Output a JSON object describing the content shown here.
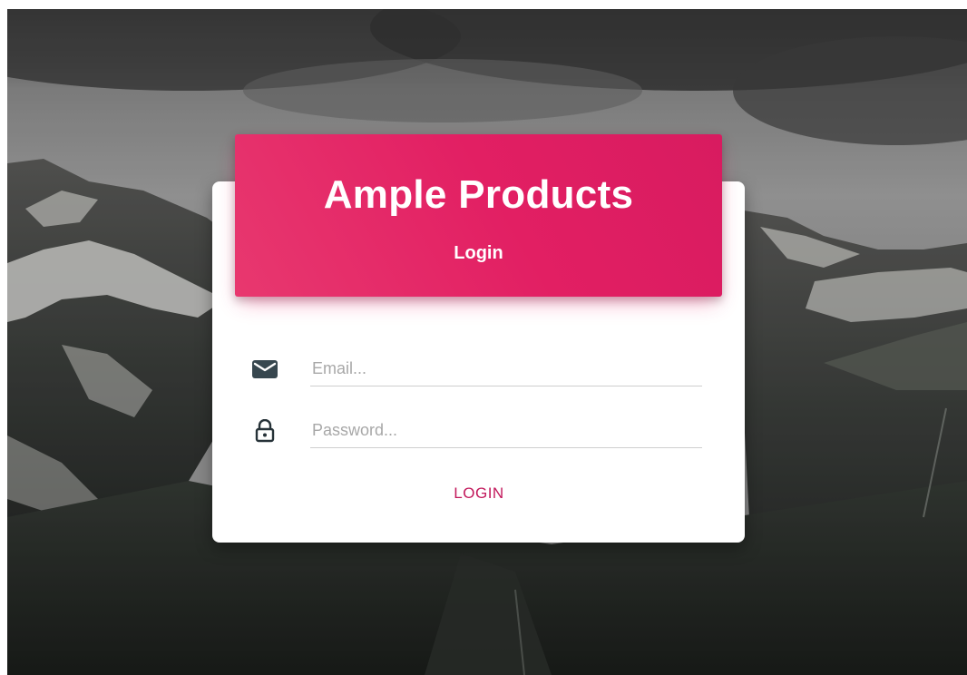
{
  "app": {
    "title": "Ample Products",
    "subtitle": "Login"
  },
  "form": {
    "email": {
      "value": "",
      "placeholder": "Email...",
      "icon": "envelope-icon"
    },
    "password": {
      "value": "",
      "placeholder": "Password...",
      "icon": "lock-icon"
    },
    "submit_label": "LOGIN"
  },
  "colors": {
    "accent": "#e91e63",
    "button_text": "#c2185b",
    "icon": "#37474f"
  }
}
